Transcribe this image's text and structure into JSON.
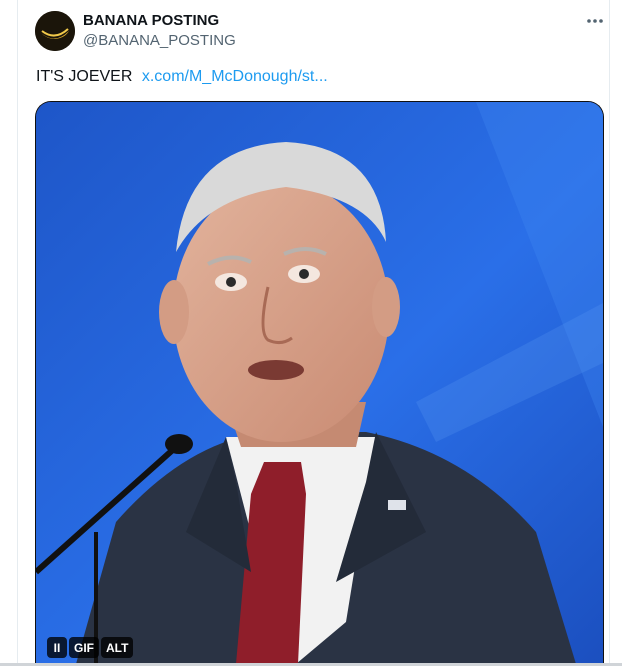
{
  "tweet": {
    "display_name": "BANANA POSTING",
    "handle": "@BANANA_POSTING",
    "text": "IT'S JOEVER",
    "link_text": "x.com/M_McDonough/st...",
    "more_label": "···"
  },
  "media": {
    "type": "gif",
    "gif_label": "GIF",
    "alt_label": "ALT",
    "pause_label": "II"
  },
  "colors": {
    "link": "#1d9bf0",
    "background_blue": "#1f5fd6",
    "suit": "#2a3344",
    "tie": "#8f1e2a"
  },
  "icons": {
    "more": "more-icon",
    "pause": "pause-icon"
  }
}
